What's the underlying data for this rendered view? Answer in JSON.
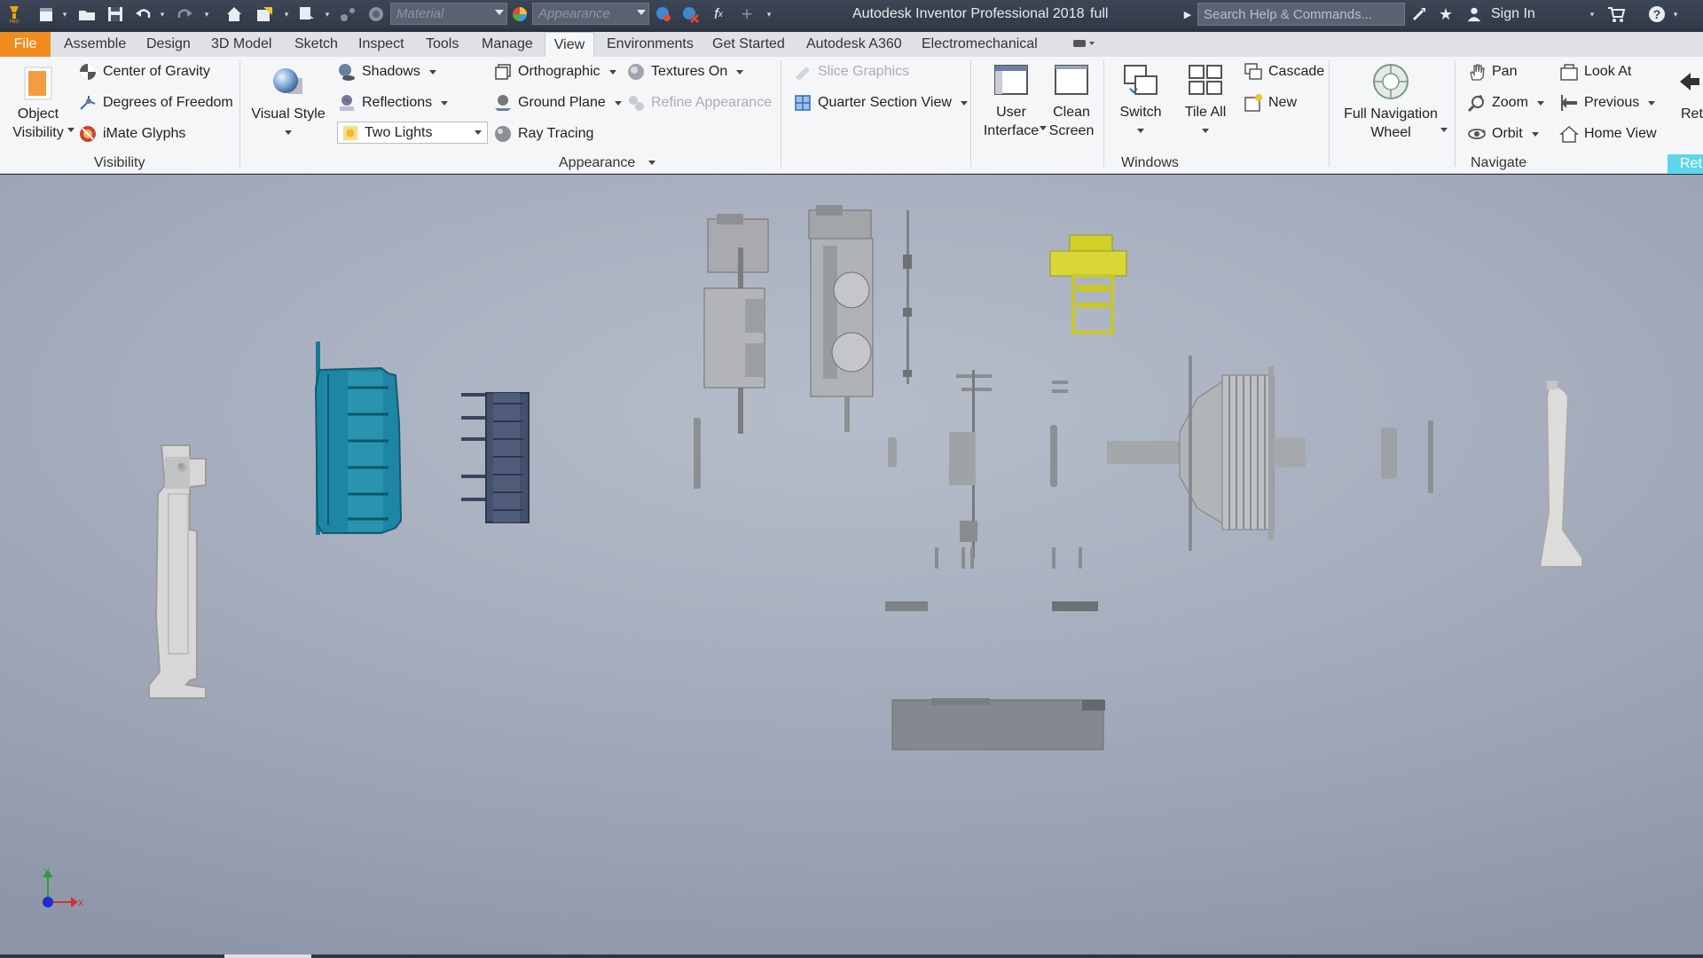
{
  "titlebar": {
    "app_title": "Autodesk Inventor Professional 2018",
    "document": "full",
    "material_placeholder": "Material",
    "appearance_placeholder": "Appearance",
    "search_placeholder": "Search Help & Commands...",
    "sign_in": "Sign In",
    "icons": [
      "pro-logo-icon",
      "new-icon",
      "open-icon",
      "save-icon",
      "undo-icon",
      "redo-icon",
      "home-icon",
      "update-icon",
      "select-icon",
      "measure-icon",
      "color-wheel-icon",
      "clear-appearance-icon",
      "formula-icon",
      "plus-icon",
      "star-icon",
      "user-icon",
      "cart-icon",
      "help-icon"
    ]
  },
  "tabs": [
    {
      "label": "File"
    },
    {
      "label": "Assemble"
    },
    {
      "label": "Design"
    },
    {
      "label": "3D Model"
    },
    {
      "label": "Sketch"
    },
    {
      "label": "Inspect"
    },
    {
      "label": "Tools"
    },
    {
      "label": "Manage"
    },
    {
      "label": "View"
    },
    {
      "label": "Environments"
    },
    {
      "label": "Get Started"
    },
    {
      "label": "Autodesk A360"
    },
    {
      "label": "Electromechanical"
    }
  ],
  "active_tab": "View",
  "ribbon": {
    "visibility": {
      "object_visibility_line1": "Object",
      "object_visibility_line2": "Visibility",
      "center_of_gravity": "Center of Gravity",
      "degrees_of_freedom": "Degrees of Freedom",
      "imate_glyphs": "iMate Glyphs",
      "label": "Visibility"
    },
    "appearance": {
      "visual_style": "Visual Style",
      "shadows": "Shadows",
      "reflections": "Reflections",
      "lighting": "Two Lights",
      "orthographic": "Orthographic",
      "ground_plane": "Ground Plane",
      "ray_tracing": "Ray Tracing",
      "textures_on": "Textures On",
      "refine_appearance": "Refine Appearance",
      "label": "Appearance"
    },
    "section": {
      "slice_graphics": "Slice Graphics",
      "quarter_section_view": "Quarter Section View"
    },
    "windows": {
      "user_interface_line1": "User",
      "user_interface_line2": "Interface",
      "clean_screen_line1": "Clean",
      "clean_screen_line2": "Screen",
      "switch": "Switch",
      "tile_all": "Tile All",
      "cascade": "Cascade",
      "new": "New",
      "label": "Windows"
    },
    "navigate": {
      "full_nav_wheel_line1": "Full Navigation",
      "full_nav_wheel_line2": "Wheel",
      "pan": "Pan",
      "zoom": "Zoom",
      "orbit": "Orbit",
      "look_at": "Look At",
      "previous": "Previous",
      "home_view": "Home View",
      "label": "Navigate"
    },
    "return": {
      "label": "Ret",
      "group": "Ret"
    }
  },
  "triad": {
    "x": "x",
    "y": "y"
  },
  "colors": {
    "file_tab": "#f08c1e",
    "title_bar": "#3a4252",
    "part_teal": "#1a7a96",
    "part_navy": "#3a4660",
    "part_yellow": "#c9c82a",
    "part_gray": "#9a9ea6",
    "return_group": "#5cd6e8"
  }
}
